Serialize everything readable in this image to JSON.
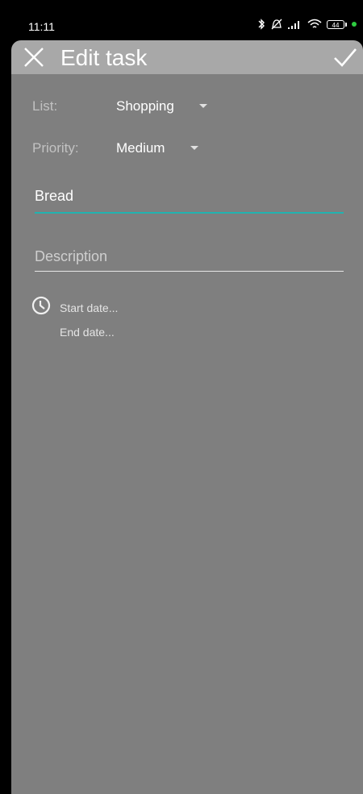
{
  "status_bar": {
    "time": "11:11",
    "battery_level": "44",
    "icons": [
      "bluetooth-icon",
      "mute-icon",
      "signal-icon",
      "wifi-icon",
      "battery-icon",
      "green-dot-icon"
    ]
  },
  "app_bar": {
    "title": "Edit task",
    "close_icon": "close-icon",
    "confirm_icon": "check-icon"
  },
  "form": {
    "list_label": "List:",
    "list_value": "Shopping",
    "priority_label": "Priority:",
    "priority_value": "Medium",
    "name_value": "Bread",
    "description_placeholder": "Description",
    "start_date": "Start date...",
    "end_date": "End date..."
  },
  "colors": {
    "accent": "#21b3b0",
    "background": "#7f7f7f",
    "app_bar": "#a8a8a8"
  }
}
